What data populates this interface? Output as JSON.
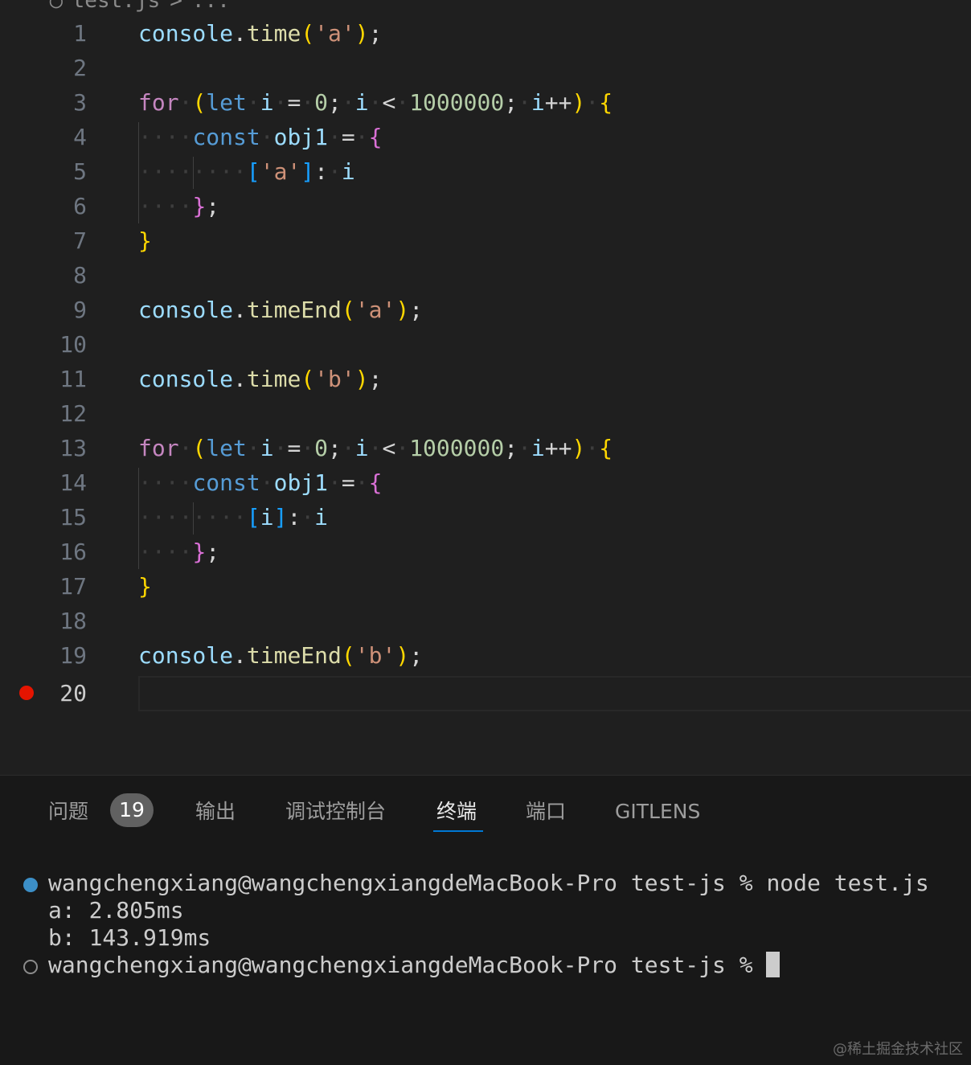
{
  "breadcrumb": {
    "icon": "js-file-icon",
    "file": "test.js",
    "separator": ">",
    "more": "..."
  },
  "editor": {
    "line_numbers": [
      "1",
      "2",
      "3",
      "4",
      "5",
      "6",
      "7",
      "8",
      "9",
      "10",
      "11",
      "12",
      "13",
      "14",
      "15",
      "16",
      "17",
      "18",
      "19",
      "20"
    ],
    "active_line": "20",
    "breakpoint_line": "20"
  },
  "panel": {
    "tabs": [
      {
        "label": "问题",
        "badge": "19"
      },
      {
        "label": "输出"
      },
      {
        "label": "调试控制台"
      },
      {
        "label": "终端",
        "active": true
      },
      {
        "label": "端口"
      },
      {
        "label": "GITLENS"
      }
    ]
  },
  "terminal": {
    "lines": [
      "wangchengxiang@wangchengxiangdeMacBook-Pro test-js % node test.js",
      "a: 2.805ms",
      "b: 143.919ms",
      "wangchengxiang@wangchengxiangdeMacBook-Pro test-js % "
    ]
  },
  "watermark": "@稀土掘金技术社区",
  "colors": {
    "background": "#1f1f1f",
    "active_tab_underline": "#0078d4",
    "breakpoint": "#e51400",
    "terminal_success_dot": "#3c8fc7"
  }
}
